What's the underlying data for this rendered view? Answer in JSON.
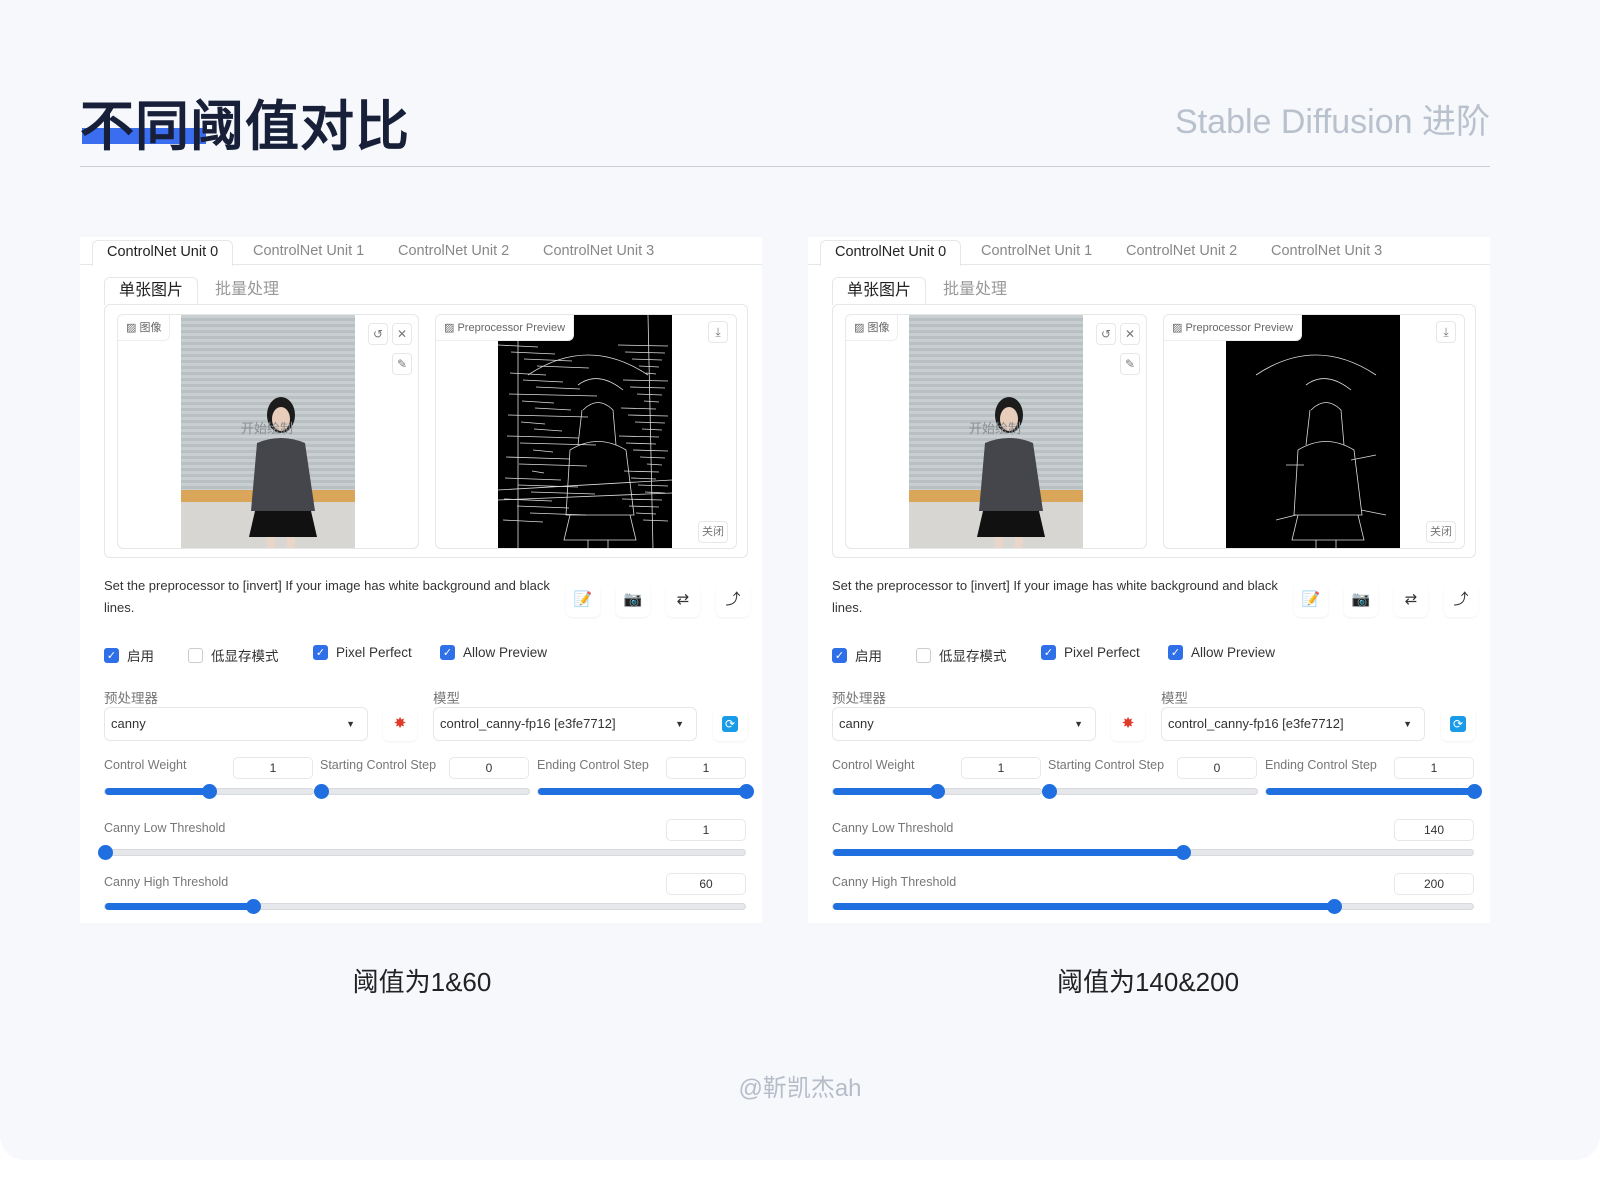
{
  "header": {
    "title": "不同阈值对比",
    "subtitle": "Stable Diffusion 进阶",
    "accent": "#3b6df0"
  },
  "panels": [
    {
      "tabs": [
        "ControlNet Unit 0",
        "ControlNet Unit 1",
        "ControlNet Unit 2",
        "ControlNet Unit 3"
      ],
      "subtabs": [
        "单张图片",
        "批量处理"
      ],
      "image_label": "图像",
      "preview_label": "Preprocessor Preview",
      "watermark": "开始绘制",
      "close_label": "关闭",
      "description": "Set the preprocessor to [invert] If your image has white background and black lines.",
      "checkboxes": [
        {
          "label": "启用",
          "checked": true
        },
        {
          "label": "低显存模式",
          "checked": false
        },
        {
          "label": "Pixel Perfect",
          "checked": true
        },
        {
          "label": "Allow Preview",
          "checked": true
        }
      ],
      "preprocessor_label": "预处理器",
      "preprocessor": "canny",
      "model_label": "模型",
      "model": "control_canny-fp16 [e3fe7712]",
      "control_weight": {
        "label": "Control Weight",
        "value": "1",
        "fraction": 0.5
      },
      "start_step": {
        "label": "Starting Control Step",
        "value": "0",
        "fraction": 0
      },
      "end_step": {
        "label": "Ending Control Step",
        "value": "1",
        "fraction": 1
      },
      "low": {
        "label": "Canny Low Threshold",
        "value": "1",
        "fraction": 0
      },
      "high": {
        "label": "Canny High Threshold",
        "value": "60",
        "fraction": 0.232
      },
      "caption": "阈值为1&60"
    },
    {
      "tabs": [
        "ControlNet Unit 0",
        "ControlNet Unit 1",
        "ControlNet Unit 2",
        "ControlNet Unit 3"
      ],
      "subtabs": [
        "单张图片",
        "批量处理"
      ],
      "image_label": "图像",
      "preview_label": "Preprocessor Preview",
      "watermark": "开始绘制",
      "close_label": "关闭",
      "description": "Set the preprocessor to [invert] If your image has white background and black lines.",
      "checkboxes": [
        {
          "label": "启用",
          "checked": true
        },
        {
          "label": "低显存模式",
          "checked": false
        },
        {
          "label": "Pixel Perfect",
          "checked": true
        },
        {
          "label": "Allow Preview",
          "checked": true
        }
      ],
      "preprocessor_label": "预处理器",
      "preprocessor": "canny",
      "model_label": "模型",
      "model": "control_canny-fp16 [e3fe7712]",
      "control_weight": {
        "label": "Control Weight",
        "value": "1",
        "fraction": 0.5
      },
      "start_step": {
        "label": "Starting Control Step",
        "value": "0",
        "fraction": 0
      },
      "end_step": {
        "label": "Ending Control Step",
        "value": "1",
        "fraction": 1
      },
      "low": {
        "label": "Canny Low Threshold",
        "value": "140",
        "fraction": 0.547
      },
      "high": {
        "label": "Canny High Threshold",
        "value": "200",
        "fraction": 0.783
      },
      "caption": "阈值为140&200"
    }
  ],
  "footer": "@靳凯杰ah"
}
